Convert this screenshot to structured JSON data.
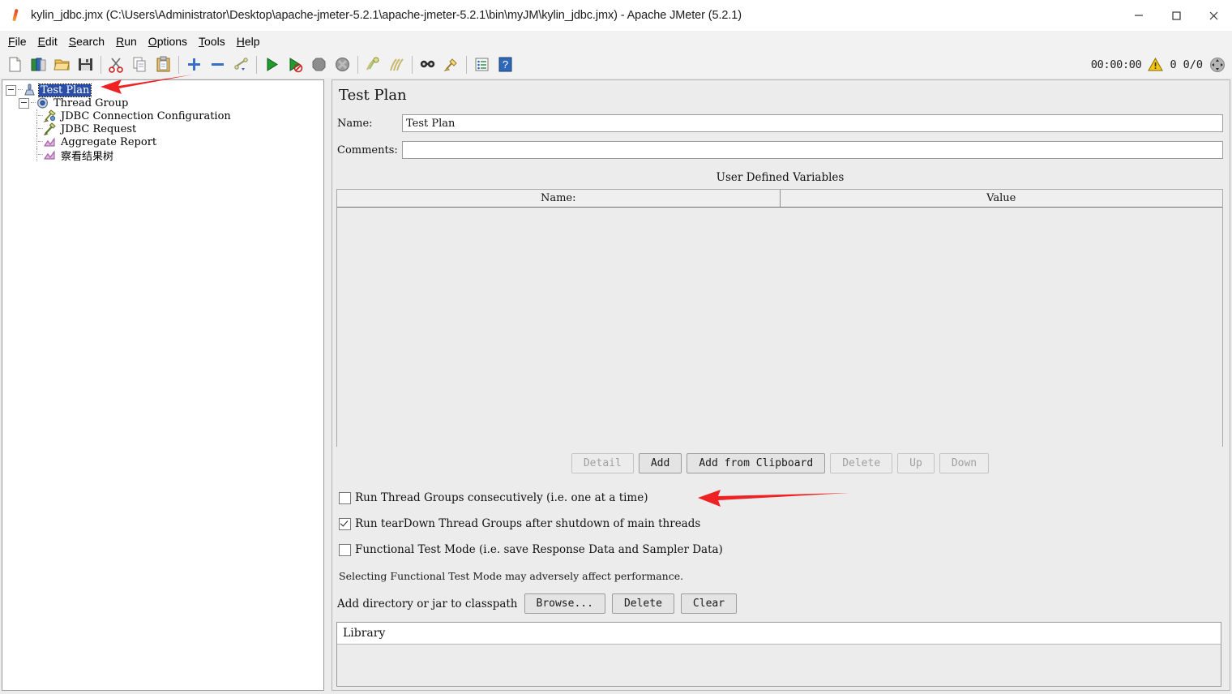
{
  "window": {
    "title": "kylin_jdbc.jmx (C:\\Users\\Administrator\\Desktop\\apache-jmeter-5.2.1\\apache-jmeter-5.2.1\\bin\\myJM\\kylin_jdbc.jmx) - Apache JMeter (5.2.1)",
    "app_icon": "jmeter-feather-icon",
    "minimize_label": "minimize-icon",
    "maximize_label": "maximize-icon",
    "close_label": "close-icon"
  },
  "menubar": {
    "items": [
      {
        "label": "File",
        "mnemonic": "F"
      },
      {
        "label": "Edit",
        "mnemonic": "E"
      },
      {
        "label": "Search",
        "mnemonic": "S"
      },
      {
        "label": "Run",
        "mnemonic": "R"
      },
      {
        "label": "Options",
        "mnemonic": "O"
      },
      {
        "label": "Tools",
        "mnemonic": "T"
      },
      {
        "label": "Help",
        "mnemonic": "H"
      }
    ]
  },
  "toolbar": {
    "buttons": [
      {
        "name": "new-icon",
        "tooltip": "New"
      },
      {
        "name": "templates-icon",
        "tooltip": "Templates"
      },
      {
        "name": "open-icon",
        "tooltip": "Open"
      },
      {
        "name": "save-icon",
        "tooltip": "Save Test Plan"
      },
      {
        "name": "cut-icon",
        "tooltip": "Cut"
      },
      {
        "name": "copy-icon",
        "tooltip": "Copy"
      },
      {
        "name": "paste-icon",
        "tooltip": "Paste"
      },
      {
        "name": "expand-all-icon",
        "tooltip": "Expand All"
      },
      {
        "name": "collapse-all-icon",
        "tooltip": "Collapse All"
      },
      {
        "name": "toggle-icon",
        "tooltip": "Toggle"
      },
      {
        "name": "start-icon",
        "tooltip": "Start"
      },
      {
        "name": "start-no-timers-icon",
        "tooltip": "Start no pauses"
      },
      {
        "name": "stop-icon",
        "tooltip": "Stop"
      },
      {
        "name": "shutdown-icon",
        "tooltip": "Shutdown"
      },
      {
        "name": "clear-icon",
        "tooltip": "Clear"
      },
      {
        "name": "clear-all-icon",
        "tooltip": "Clear All"
      },
      {
        "name": "search-icon",
        "tooltip": "Search"
      },
      {
        "name": "search-reset-icon",
        "tooltip": "Reset Search"
      },
      {
        "name": "function-helper-icon",
        "tooltip": "Function Helper Dialog"
      },
      {
        "name": "help-icon",
        "tooltip": "Help"
      }
    ],
    "status": {
      "elapsed_time": "00:00:00",
      "warning_icon": "warning-triangle-icon",
      "warning_count": "0",
      "threads": "0/0",
      "expand_icon": "expand-status-icon"
    }
  },
  "tree": {
    "nodes": [
      {
        "label": "Test Plan",
        "icon": "test-plan-icon",
        "depth": 0,
        "selected": true,
        "expandable": true
      },
      {
        "label": "Thread Group",
        "icon": "thread-group-icon",
        "depth": 1,
        "selected": false,
        "expandable": true
      },
      {
        "label": "JDBC Connection Configuration",
        "icon": "config-element-icon",
        "depth": 2,
        "selected": false,
        "expandable": false
      },
      {
        "label": "JDBC Request",
        "icon": "sampler-icon",
        "depth": 2,
        "selected": false,
        "expandable": false
      },
      {
        "label": "Aggregate Report",
        "icon": "listener-icon",
        "depth": 2,
        "selected": false,
        "expandable": false
      },
      {
        "label": "察看结果树",
        "icon": "listener-icon",
        "depth": 2,
        "selected": false,
        "expandable": false
      }
    ]
  },
  "main": {
    "heading": "Test Plan",
    "name_label": "Name:",
    "name_value": "Test Plan",
    "comments_label": "Comments:",
    "comments_value": "",
    "comments_placeholder": "",
    "udv": {
      "title": "User Defined Variables",
      "columns": [
        "Name:",
        "Value"
      ],
      "rows": []
    },
    "table_buttons": [
      {
        "label": "Detail",
        "enabled": false
      },
      {
        "label": "Add",
        "enabled": true
      },
      {
        "label": "Add from Clipboard",
        "enabled": true
      },
      {
        "label": "Delete",
        "enabled": false
      },
      {
        "label": "Up",
        "enabled": false
      },
      {
        "label": "Down",
        "enabled": false
      }
    ],
    "checkboxes": [
      {
        "label": "Run Thread Groups consecutively (i.e. one at a time)",
        "checked": false
      },
      {
        "label": "Run tearDown Thread Groups after shutdown of main threads",
        "checked": true
      },
      {
        "label": "Functional Test Mode (i.e. save Response Data and Sampler Data)",
        "checked": false
      }
    ],
    "note": "Selecting Functional Test Mode may adversely affect performance.",
    "classpath": {
      "label": "Add directory or jar to classpath",
      "buttons": [
        {
          "label": "Browse...",
          "enabled": true
        },
        {
          "label": "Delete",
          "enabled": true
        },
        {
          "label": "Clear",
          "enabled": true
        }
      ],
      "table_header": "Library",
      "rows": []
    }
  },
  "annotations": {
    "arrow_color": "#ee2222",
    "arrows": [
      {
        "name": "arrow-to-test-plan-node",
        "points_to": "Test Plan"
      },
      {
        "name": "arrow-to-run-consecutively-checkbox",
        "points_to": "Run Thread Groups consecutively (i.e. one at a time)"
      }
    ]
  },
  "colors": {
    "panel_bg": "#ececec",
    "tree_bg": "#ffffff",
    "selection_blue": "#2a4ea8",
    "accent_red": "#ee2222"
  }
}
